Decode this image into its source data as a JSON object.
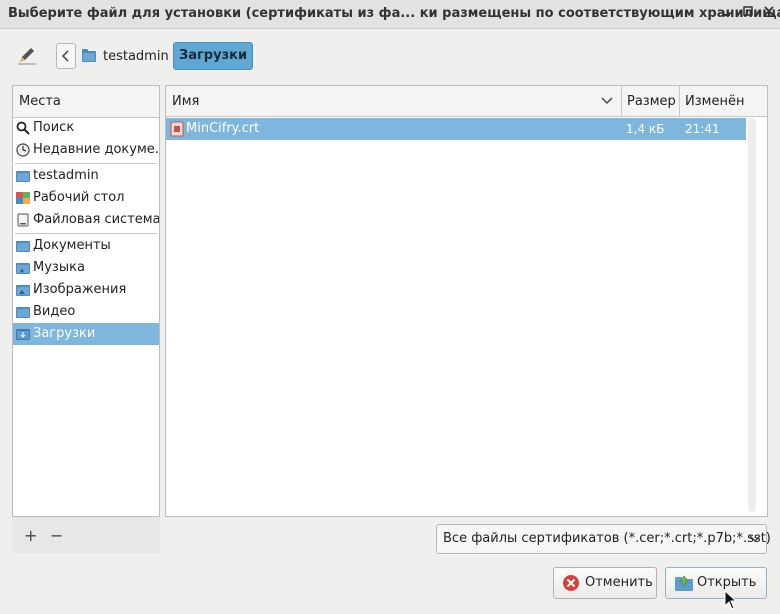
{
  "window": {
    "title": "Выберите файл для установки (сертификаты из фа... ки размещены по соответствующим хранилищам)",
    "controls": [
      "minimize",
      "maximize",
      "close"
    ]
  },
  "breadcrumb": {
    "home": "testadmin",
    "current": "Загрузки"
  },
  "places": {
    "header": "Места",
    "items": [
      {
        "label": "Поиск",
        "icon": "search-icon"
      },
      {
        "label": "Недавние докуме...",
        "icon": "clock-icon"
      },
      {
        "label": "testadmin",
        "icon": "home-folder-icon"
      },
      {
        "label": "Рабочий стол",
        "icon": "desktop-icon"
      },
      {
        "label": "Файловая система",
        "icon": "drive-icon"
      },
      {
        "label": "Документы",
        "icon": "folder-icon"
      },
      {
        "label": "Музыка",
        "icon": "music-folder-icon"
      },
      {
        "label": "Изображения",
        "icon": "pictures-folder-icon"
      },
      {
        "label": "Видео",
        "icon": "video-folder-icon"
      },
      {
        "label": "Загрузки",
        "icon": "downloads-folder-icon",
        "selected": true
      }
    ],
    "add": "+",
    "remove": "−"
  },
  "files": {
    "columns": {
      "name": "Имя",
      "size": "Размер",
      "modified": "Изменён"
    },
    "rows": [
      {
        "name": "MinCifry.crt",
        "size": "1,4 кБ",
        "modified": "21:41",
        "icon": "certificate-icon",
        "selected": true
      }
    ]
  },
  "filter": {
    "selected": "Все файлы сертификатов (*.cer;*.crt;*.p7b;*.sst)"
  },
  "buttons": {
    "cancel": "Отменить",
    "open": "Открыть"
  },
  "colors": {
    "selection": "#7eb6de",
    "active_crumb": "#5fa8d3"
  }
}
